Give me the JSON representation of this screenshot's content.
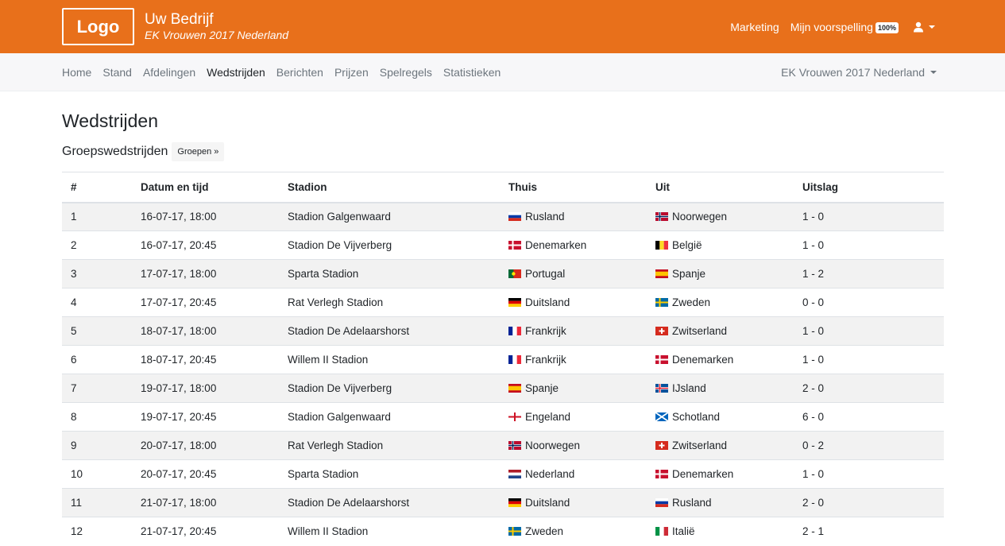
{
  "header": {
    "logo": "Logo",
    "brand_name": "Uw Bedrijf",
    "brand_sub": "EK Vrouwen 2017 Nederland",
    "marketing": "Marketing",
    "prediction": "Mijn voorspelling",
    "prediction_badge": "100%",
    "accent_color": "#e8701b"
  },
  "subnav": {
    "items": [
      {
        "label": "Home"
      },
      {
        "label": "Stand"
      },
      {
        "label": "Afdelingen"
      },
      {
        "label": "Wedstrijden"
      },
      {
        "label": "Berichten"
      },
      {
        "label": "Prijzen"
      },
      {
        "label": "Spelregels"
      },
      {
        "label": "Statistieken"
      }
    ],
    "active": "Wedstrijden",
    "tournament": "EK Vrouwen 2017 Nederland"
  },
  "main": {
    "title": "Wedstrijden",
    "section": "Groepswedstrijden",
    "groups_button": "Groepen »",
    "columns": [
      "#",
      "Datum en tijd",
      "Stadion",
      "Thuis",
      "Uit",
      "Uitslag"
    ],
    "rows": [
      {
        "num": "1",
        "date": "16-07-17, 18:00",
        "stadium": "Stadion Galgenwaard",
        "home": "Rusland",
        "home_flag": "russia-flag-icon",
        "away": "Noorwegen",
        "away_flag": "norway-flag-icon",
        "score": "1 - 0"
      },
      {
        "num": "2",
        "date": "16-07-17, 20:45",
        "stadium": "Stadion De Vijverberg",
        "home": "Denemarken",
        "home_flag": "denmark-flag-icon",
        "away": "België",
        "away_flag": "belgium-flag-icon",
        "score": "1 - 0"
      },
      {
        "num": "3",
        "date": "17-07-17, 18:00",
        "stadium": "Sparta Stadion",
        "home": "Portugal",
        "home_flag": "portugal-flag-icon",
        "away": "Spanje",
        "away_flag": "spain-flag-icon",
        "score": "1 - 2"
      },
      {
        "num": "4",
        "date": "17-07-17, 20:45",
        "stadium": "Rat Verlegh Stadion",
        "home": "Duitsland",
        "home_flag": "germany-flag-icon",
        "away": "Zweden",
        "away_flag": "sweden-flag-icon",
        "score": "0 - 0"
      },
      {
        "num": "5",
        "date": "18-07-17, 18:00",
        "stadium": "Stadion De Adelaarshorst",
        "home": "Frankrijk",
        "home_flag": "france-flag-icon",
        "away": "Zwitserland",
        "away_flag": "switzerland-flag-icon",
        "score": "1 - 0"
      },
      {
        "num": "6",
        "date": "18-07-17, 20:45",
        "stadium": "Willem II Stadion",
        "home": "Frankrijk",
        "home_flag": "france-flag-icon",
        "away": "Denemarken",
        "away_flag": "denmark-flag-icon",
        "score": "1 - 0"
      },
      {
        "num": "7",
        "date": "19-07-17, 18:00",
        "stadium": "Stadion De Vijverberg",
        "home": "Spanje",
        "home_flag": "spain-flag-icon",
        "away": "IJsland",
        "away_flag": "iceland-flag-icon",
        "score": "2 - 0"
      },
      {
        "num": "8",
        "date": "19-07-17, 20:45",
        "stadium": "Stadion Galgenwaard",
        "home": "Engeland",
        "home_flag": "england-flag-icon",
        "away": "Schotland",
        "away_flag": "scotland-flag-icon",
        "score": "6 - 0"
      },
      {
        "num": "9",
        "date": "20-07-17, 18:00",
        "stadium": "Rat Verlegh Stadion",
        "home": "Noorwegen",
        "home_flag": "norway-flag-icon",
        "away": "Zwitserland",
        "away_flag": "switzerland-flag-icon",
        "score": "0 - 2"
      },
      {
        "num": "10",
        "date": "20-07-17, 20:45",
        "stadium": "Sparta Stadion",
        "home": "Nederland",
        "home_flag": "netherlands-flag-icon",
        "away": "Denemarken",
        "away_flag": "denmark-flag-icon",
        "score": "1 - 0"
      },
      {
        "num": "11",
        "date": "21-07-17, 18:00",
        "stadium": "Stadion De Adelaarshorst",
        "home": "Duitsland",
        "home_flag": "germany-flag-icon",
        "away": "Rusland",
        "away_flag": "russia-flag-icon",
        "score": "2 - 0"
      },
      {
        "num": "12",
        "date": "21-07-17, 20:45",
        "stadium": "Willem II Stadion",
        "home": "Zweden",
        "home_flag": "sweden-flag-icon",
        "away": "Italië",
        "away_flag": "italy-flag-icon",
        "score": "2 - 1"
      }
    ]
  }
}
